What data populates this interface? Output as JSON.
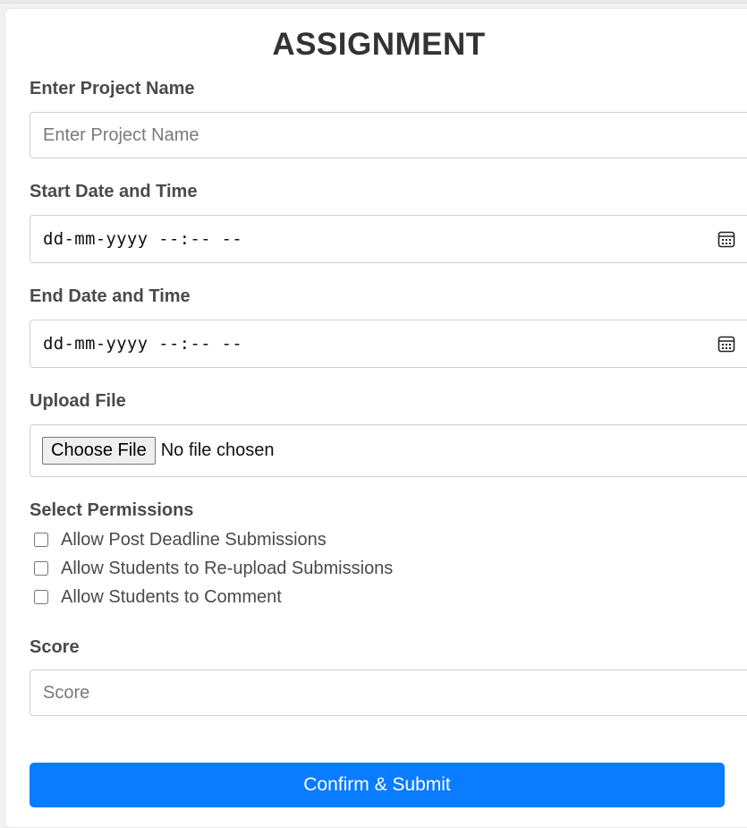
{
  "form": {
    "title": "ASSIGNMENT",
    "project_name": {
      "label": "Enter Project Name",
      "placeholder": "Enter Project Name",
      "value": ""
    },
    "start_datetime": {
      "label": "Start Date and Time",
      "display": "dd-mm-yyyy --:-- --"
    },
    "end_datetime": {
      "label": "End Date and Time",
      "display": "dd-mm-yyyy --:-- --"
    },
    "upload": {
      "label": "Upload File",
      "button_label": "Choose File",
      "status": "No file chosen"
    },
    "permissions": {
      "label": "Select Permissions",
      "options": [
        {
          "label": "Allow Post Deadline Submissions",
          "checked": false
        },
        {
          "label": "Allow Students to Re-upload Submissions",
          "checked": false
        },
        {
          "label": "Allow Students to Comment",
          "checked": false
        }
      ]
    },
    "score": {
      "label": "Score",
      "placeholder": "Score",
      "value": ""
    },
    "submit_label": "Confirm & Submit"
  },
  "colors": {
    "accent": "#0a7cff",
    "title": "#333333",
    "label": "#4a4a4a",
    "border": "#cfcfcf"
  },
  "icons": {
    "datetime_picker": "calendar-icon"
  }
}
